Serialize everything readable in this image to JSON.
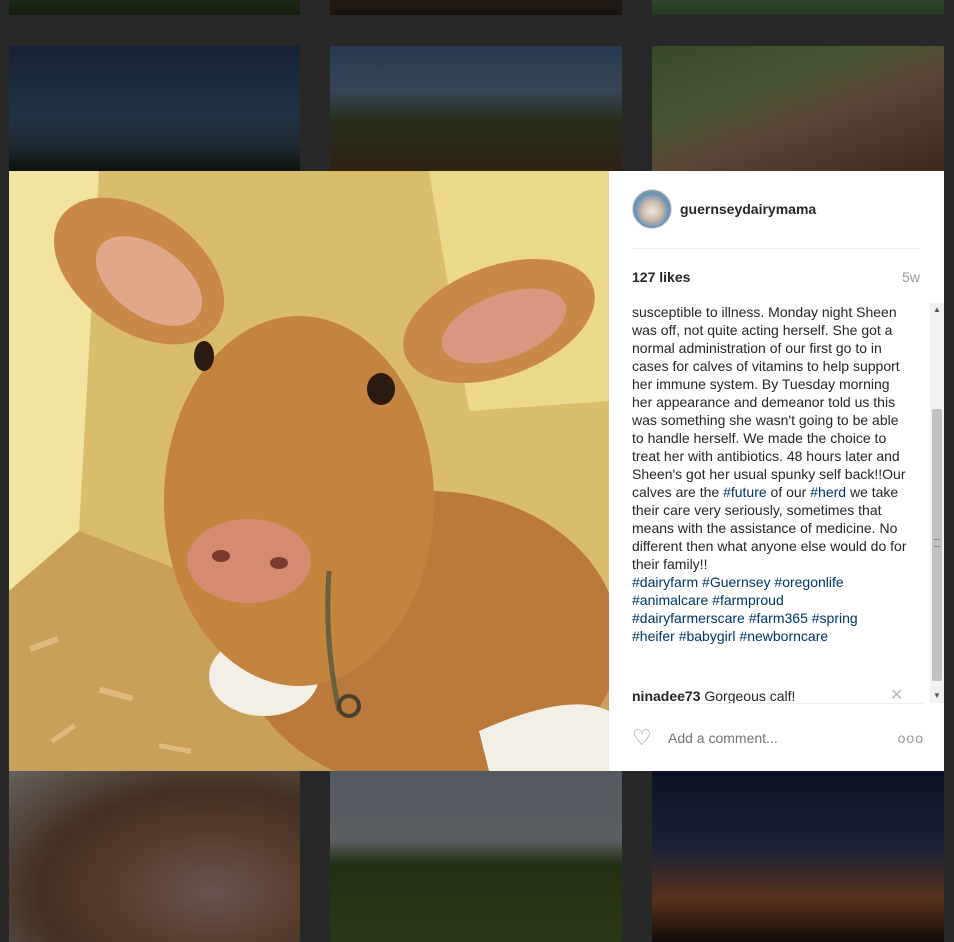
{
  "post": {
    "username": "guernseydairymama",
    "likes": "127 likes",
    "age": "5w"
  },
  "caption": {
    "text_part1": "susceptible to illness. Monday night Sheen was off, not quite acting herself. She got a normal administration of our first go to in cases for calves of vitamins to help support her immune system. By Tuesday morning her appearance and demeanor told us this was something she wasn't going to be able to handle herself. We made the choice to treat her with antibiotics. 48 hours later and Sheen's got her usual spunky self back!!Our calves are the ",
    "tag_future": "#future",
    "text_part2": " of our ",
    "tag_herd": "#herd",
    "text_part3": " we take their care very seriously, sometimes that means with the assistance of medicine. No different then what anyone else would do for their family!!",
    "hashtags": [
      "#dairyfarm",
      "#Guernsey",
      "#oregonlife",
      "#animalcare",
      "#farmproud",
      "#dairyfarmerscare",
      "#farm365",
      "#spring",
      "#heifer",
      "#babygirl",
      "#newborncare"
    ]
  },
  "comment": {
    "user": "ninadee73",
    "text": " Gorgeous calf!"
  },
  "footer": {
    "comment_placeholder": "Add a comment...",
    "more_label": "ooo"
  },
  "icons": {
    "heart": "heart-icon",
    "close": "close-icon",
    "more": "more-options-icon"
  }
}
